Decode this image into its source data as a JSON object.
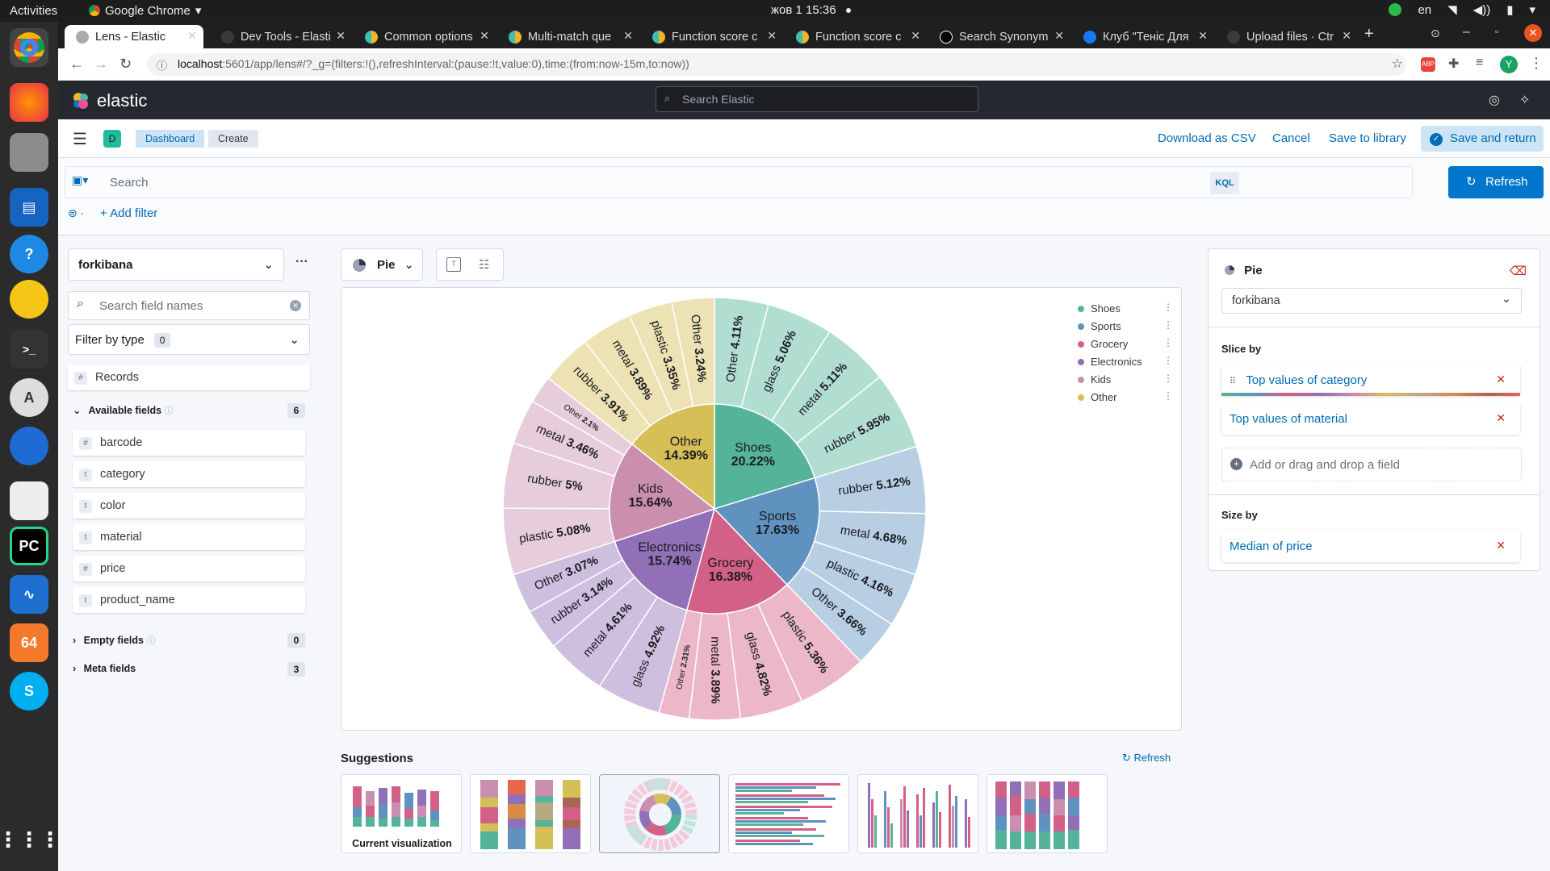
{
  "os": {
    "activities": "Activities",
    "app_name": "Google Chrome",
    "clock": "жов 1  15:36",
    "lang": "en"
  },
  "browser": {
    "tabs": [
      {
        "label": "Lens - Elastic",
        "color": "#888"
      },
      {
        "label": "Dev Tools - Elasti",
        "color": "#3a3a3a"
      },
      {
        "label": "Common options",
        "color": "#f0b429"
      },
      {
        "label": "Multi-match que",
        "color": "#f0b429"
      },
      {
        "label": "Function score c",
        "color": "#f0b429"
      },
      {
        "label": "Function score c",
        "color": "#f0b429"
      },
      {
        "label": "Search Synonym",
        "color": "#000"
      },
      {
        "label": "Клуб \"Теніс Для",
        "color": "#1877f2"
      },
      {
        "label": "Upload files · Ctr",
        "color": "#3a3a3a"
      }
    ],
    "url_host": "localhost",
    "url_rest": ":5601/app/lens#/?_g=(filters:!(),refreshInterval:(pause:!t,value:0),time:(from:now-15m,to:now))",
    "profile_initial": "Y"
  },
  "kibana": {
    "brand": "elastic",
    "global_search_placeholder": "Search Elastic",
    "space_initial": "D",
    "breadcrumbs": [
      "Dashboard",
      "Create"
    ],
    "header_actions": {
      "download": "Download as CSV",
      "cancel": "Cancel",
      "save_library": "Save to library",
      "save_return": "Save and return"
    },
    "query": {
      "placeholder": "Search",
      "language": "KQL",
      "refresh": "Refresh",
      "add_filter": "+ Add filter"
    }
  },
  "datapanel": {
    "index_pattern": "forkibana",
    "search_placeholder": "Search field names",
    "filter_by_type": "Filter by type",
    "filter_count": "0",
    "records": "Records",
    "available_label": "Available fields",
    "available_count": "6",
    "fields": [
      {
        "name": "barcode",
        "type": "#"
      },
      {
        "name": "category",
        "type": "t"
      },
      {
        "name": "color",
        "type": "t"
      },
      {
        "name": "material",
        "type": "t"
      },
      {
        "name": "price",
        "type": "#"
      },
      {
        "name": "product_name",
        "type": "t"
      }
    ],
    "empty_label": "Empty fields",
    "empty_count": "0",
    "meta_label": "Meta fields",
    "meta_count": "3"
  },
  "workspace": {
    "chart_type_label": "Pie",
    "suggestions_title": "Suggestions",
    "suggestions_refresh": "Refresh",
    "current_viz_label": "Current visualization"
  },
  "config": {
    "chart_label": "Pie",
    "layer_index": "forkibana",
    "slice_by_label": "Slice by",
    "slice_dims": [
      "Top values of category",
      "Top values of material"
    ],
    "add_field": "Add or drag and drop a field",
    "size_by_label": "Size by",
    "size_dim": "Median of price"
  },
  "colors": {
    "shoes": "#54B399",
    "sports": "#6092C0",
    "grocery": "#D36086",
    "electronics": "#9170B8",
    "kids": "#CA8EAE",
    "other": "#D6BF57",
    "accent": "#006bb4",
    "primary_button": "#0077cc"
  },
  "chart_data": {
    "type": "pie",
    "legend_position": "top-right",
    "legend": [
      "Shoes",
      "Sports",
      "Grocery",
      "Electronics",
      "Kids",
      "Other"
    ],
    "inner": [
      {
        "label": "Shoes",
        "value": 20.22
      },
      {
        "label": "Sports",
        "value": 17.63
      },
      {
        "label": "Grocery",
        "value": 16.38
      },
      {
        "label": "Electronics",
        "value": 15.74
      },
      {
        "label": "Kids",
        "value": 15.64
      },
      {
        "label": "Other",
        "value": 14.39
      }
    ],
    "outer": [
      {
        "parent": "Shoes",
        "label": "Other",
        "value": 4.11
      },
      {
        "parent": "Shoes",
        "label": "glass",
        "value": 5.06
      },
      {
        "parent": "Shoes",
        "label": "metal",
        "value": 5.11
      },
      {
        "parent": "Shoes",
        "label": "rubber",
        "value": 5.95
      },
      {
        "parent": "Sports",
        "label": "rubber",
        "value": 5.12
      },
      {
        "parent": "Sports",
        "label": "metal",
        "value": 4.68
      },
      {
        "parent": "Sports",
        "label": "plastic",
        "value": 4.16
      },
      {
        "parent": "Sports",
        "label": "Other",
        "value": 3.66
      },
      {
        "parent": "Grocery",
        "label": "plastic",
        "value": 5.36
      },
      {
        "parent": "Grocery",
        "label": "glass",
        "value": 4.82
      },
      {
        "parent": "Grocery",
        "label": "metal",
        "value": 3.89
      },
      {
        "parent": "Grocery",
        "label": "Other",
        "value": 2.31
      },
      {
        "parent": "Electronics",
        "label": "glass",
        "value": 4.92
      },
      {
        "parent": "Electronics",
        "label": "metal",
        "value": 4.61
      },
      {
        "parent": "Electronics",
        "label": "rubber",
        "value": 3.14
      },
      {
        "parent": "Electronics",
        "label": "Other",
        "value": 3.07
      },
      {
        "parent": "Kids",
        "label": "plastic",
        "value": 5.08
      },
      {
        "parent": "Kids",
        "label": "rubber",
        "value": 5.0
      },
      {
        "parent": "Kids",
        "label": "metal",
        "value": 3.46
      },
      {
        "parent": "Kids",
        "label": "Other",
        "value": 2.1
      },
      {
        "parent": "Other",
        "label": "rubber",
        "value": 3.91
      },
      {
        "parent": "Other",
        "label": "metal",
        "value": 3.89
      },
      {
        "parent": "Other",
        "label": "plastic",
        "value": 3.35
      },
      {
        "parent": "Other",
        "label": "Other",
        "value": 3.24
      }
    ]
  }
}
